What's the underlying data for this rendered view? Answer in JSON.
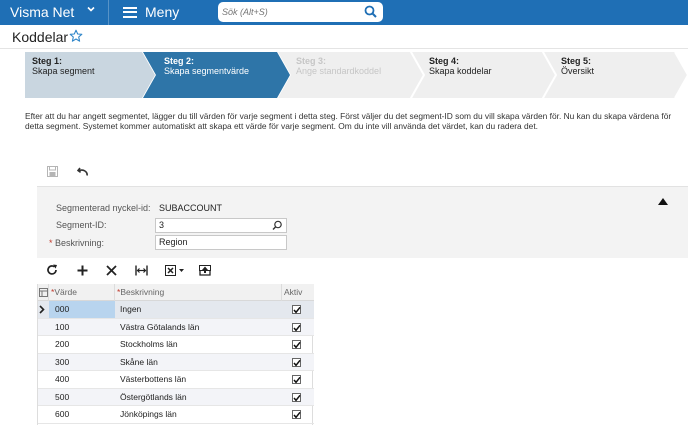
{
  "topbar": {
    "brand": "Visma Net",
    "menu_label": "Meny",
    "search_placeholder": "Sök (Alt+S)"
  },
  "page": {
    "title": "Koddelar"
  },
  "wizard": {
    "steps": [
      {
        "num": "Steg 1:",
        "label": "Skapa segment",
        "state": "done"
      },
      {
        "num": "Steg 2:",
        "label": "Skapa segmentvärde",
        "state": "active"
      },
      {
        "num": "Steg 3:",
        "label": "Ange standardkoddel",
        "state": "disabled"
      },
      {
        "num": "Steg 4:",
        "label": "Skapa koddelar",
        "state": "pending"
      },
      {
        "num": "Steg 5:",
        "label": "Översikt",
        "state": "pending"
      }
    ]
  },
  "description": "Efter att du har angett segmentet, lägger du till värden för varje segment i detta steg. Först väljer du det segment-ID som du vill skapa värden för. Nu kan du skapa värdena för detta segment. Systemet kommer automatiskt att skapa ett värde för varje segment. Om du inte vill använda det värdet, kan du radera det.",
  "form": {
    "segmented_key_label": "Segmenterad nyckel-id:",
    "segmented_key_value": "SUBACCOUNT",
    "segment_id_label": "Segment-ID:",
    "segment_id_value": "3",
    "description_label": "Beskrivning:",
    "description_value": "Region"
  },
  "grid": {
    "columns": {
      "value": "Värde",
      "description": "Beskrivning",
      "active": "Aktiv"
    },
    "rows": [
      {
        "value": "000",
        "description": "Ingen",
        "active": true
      },
      {
        "value": "100",
        "description": "Västra Götalands län",
        "active": true
      },
      {
        "value": "200",
        "description": "Stockholms län",
        "active": true
      },
      {
        "value": "300",
        "description": "Skåne län",
        "active": true
      },
      {
        "value": "400",
        "description": "Västerbottens län",
        "active": true
      },
      {
        "value": "500",
        "description": "Östergötlands län",
        "active": true
      },
      {
        "value": "600",
        "description": "Jönköpings län",
        "active": true
      }
    ]
  },
  "colors": {
    "topbar": "#1f6fb5",
    "step_done": "#c9d6e0",
    "step_active": "#2e75a8",
    "step_pending": "#eeeeee",
    "row_selected": "#b8d4ee"
  }
}
